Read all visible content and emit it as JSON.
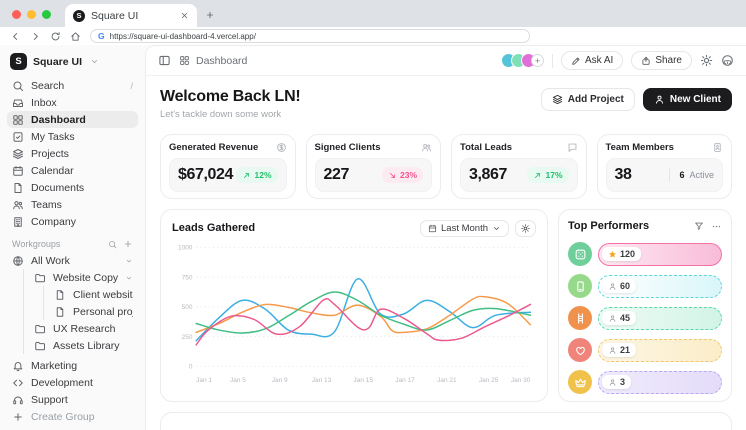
{
  "browser": {
    "tab_title": "Square UI",
    "url": "https://square-ui-dashboard-4.vercel.app/"
  },
  "sidebar": {
    "workspace": {
      "name": "Square UI",
      "logo_letter": "S"
    },
    "nav": [
      {
        "label": "Search",
        "icon": "search",
        "shortcut": "/"
      },
      {
        "label": "Inbox",
        "icon": "inbox"
      },
      {
        "label": "Dashboard",
        "icon": "grid",
        "active": true
      },
      {
        "label": "My Tasks",
        "icon": "tasks"
      },
      {
        "label": "Projects",
        "icon": "layers"
      },
      {
        "label": "Calendar",
        "icon": "calendar"
      },
      {
        "label": "Documents",
        "icon": "document"
      },
      {
        "label": "Teams",
        "icon": "people"
      },
      {
        "label": "Company",
        "icon": "building"
      }
    ],
    "workgroups": {
      "label": "Workgroups",
      "tree": [
        {
          "label": "All Work",
          "icon": "globe",
          "level": 0,
          "chevron": "down"
        },
        {
          "label": "Website Copy",
          "icon": "folder",
          "level": 1,
          "chevron": "down"
        },
        {
          "label": "Client website",
          "icon": "file",
          "level": 2
        },
        {
          "label": "Personal project",
          "icon": "file",
          "level": 2
        },
        {
          "label": "UX Research",
          "icon": "folder",
          "level": 1
        },
        {
          "label": "Assets Library",
          "icon": "folder",
          "level": 1
        }
      ]
    },
    "footer_nav": [
      {
        "label": "Marketing",
        "icon": "bell"
      },
      {
        "label": "Development",
        "icon": "code"
      },
      {
        "label": "Support",
        "icon": "headset"
      }
    ],
    "create_group": "Create Group"
  },
  "topbar": {
    "breadcrumb": "Dashboard",
    "ask_ai": "Ask AI",
    "share": "Share",
    "avatars": [
      {
        "color": "#56c4d8"
      },
      {
        "color": "#7fe0b8"
      },
      {
        "color": "#e06fd8"
      }
    ]
  },
  "welcome": {
    "title": "Welcome Back LN!",
    "subtitle": "Let's tackle down some work",
    "add_project": "Add Project",
    "new_client": "New Client"
  },
  "colors": {
    "positive": "#1fc16b",
    "negative": "#f6508c",
    "primary_button": "#1c1c1e"
  },
  "stats": [
    {
      "label": "Generated Revenue",
      "icon": "coin",
      "value": "$67,024",
      "trend": "up",
      "trend_value": "12%"
    },
    {
      "label": "Signed Clients",
      "icon": "people",
      "value": "227",
      "trend": "down",
      "trend_value": "23%"
    },
    {
      "label": "Total Leads",
      "icon": "chat",
      "value": "3,867",
      "trend": "up",
      "trend_value": "17%"
    },
    {
      "label": "Team Members",
      "icon": "badge",
      "value": "38",
      "trend": "none",
      "trend_value": "6 Active"
    }
  ],
  "chart_card": {
    "title": "Leads Gathered",
    "range_label": "Last Month"
  },
  "chart_data": {
    "type": "line",
    "title": "Leads Gathered",
    "xlabel": "",
    "ylabel": "",
    "x_tick_labels": [
      "Jan 1",
      "Jan 5",
      "Jan 9",
      "Jan 13",
      "Jan 15",
      "Jan 17",
      "Jan 21",
      "Jan 25",
      "Jan 30"
    ],
    "y_ticks": [
      0,
      250,
      500,
      750,
      1000
    ],
    "ylim": [
      0,
      1000
    ],
    "xlim": [
      1,
      30
    ],
    "grid": "dotted-horizontal",
    "legend": "none",
    "series": [
      {
        "name": "blue",
        "color": "#3bafe3",
        "points": [
          [
            1,
            215
          ],
          [
            3,
            410
          ],
          [
            5,
            555
          ],
          [
            7,
            480
          ],
          [
            9,
            305
          ],
          [
            11,
            270
          ],
          [
            13,
            290
          ],
          [
            15,
            735
          ],
          [
            17,
            440
          ],
          [
            19,
            440
          ],
          [
            21,
            555
          ],
          [
            23,
            460
          ],
          [
            25,
            325
          ],
          [
            27,
            430
          ],
          [
            30,
            455
          ]
        ]
      },
      {
        "name": "orange",
        "color": "#f59a4b",
        "points": [
          [
            1,
            285
          ],
          [
            3,
            360
          ],
          [
            5,
            455
          ],
          [
            7,
            520
          ],
          [
            9,
            495
          ],
          [
            11,
            450
          ],
          [
            13,
            430
          ],
          [
            15,
            515
          ],
          [
            17,
            420
          ],
          [
            18,
            300
          ],
          [
            19,
            285
          ],
          [
            21,
            315
          ],
          [
            23,
            430
          ],
          [
            25,
            565
          ],
          [
            26,
            585
          ],
          [
            28,
            530
          ],
          [
            30,
            350
          ]
        ]
      },
      {
        "name": "green",
        "color": "#41be83",
        "points": [
          [
            1,
            360
          ],
          [
            3,
            305
          ],
          [
            5,
            280
          ],
          [
            7,
            315
          ],
          [
            9,
            425
          ],
          [
            11,
            545
          ],
          [
            13,
            625
          ],
          [
            15,
            555
          ],
          [
            17,
            430
          ],
          [
            19,
            355
          ],
          [
            21,
            305
          ],
          [
            23,
            385
          ],
          [
            25,
            470
          ],
          [
            27,
            485
          ],
          [
            30,
            430
          ]
        ]
      },
      {
        "name": "pink",
        "color": "#ea5a8f",
        "points": [
          [
            1,
            180
          ],
          [
            2,
            300
          ],
          [
            4,
            420
          ],
          [
            6,
            395
          ],
          [
            8,
            270
          ],
          [
            10,
            335
          ],
          [
            12,
            555
          ],
          [
            13,
            520
          ],
          [
            15,
            330
          ],
          [
            16,
            325
          ],
          [
            17,
            480
          ],
          [
            19,
            405
          ],
          [
            21,
            275
          ],
          [
            22,
            220
          ],
          [
            24,
            235
          ],
          [
            26,
            330
          ],
          [
            28,
            420
          ],
          [
            30,
            520
          ]
        ]
      }
    ]
  },
  "performers": {
    "title": "Top Performers",
    "rows": [
      {
        "avatar_icon": "dice",
        "avatar_color": "#6fcf9b",
        "badge_icon": "star",
        "value": "120",
        "accent": "#f272a6",
        "fill_from": "#ffe9f3",
        "fill_to": "#f8bcd8",
        "border_style": "solid"
      },
      {
        "avatar_icon": "phone",
        "avatar_color": "#97d98b",
        "badge_icon": "person",
        "value": "60",
        "accent": "#5bd4de",
        "fill_from": "#ffffff",
        "fill_to": "#d9f6f9",
        "border_style": "dashed"
      },
      {
        "avatar_icon": "ladder",
        "avatar_color": "#f0924c",
        "badge_icon": "person",
        "value": "45",
        "accent": "#57d6a9",
        "fill_from": "#eefbf5",
        "fill_to": "#d2f4e6",
        "border_style": "dashed"
      },
      {
        "avatar_icon": "heart",
        "avatar_color": "#f0837a",
        "badge_icon": "person",
        "value": "21",
        "accent": "#f2c76b",
        "fill_from": "#fdf6e4",
        "fill_to": "#fbedc9",
        "border_style": "dashed"
      },
      {
        "avatar_icon": "crown",
        "avatar_color": "#f0c24b",
        "badge_icon": "person",
        "value": "3",
        "accent": "#b9a7ef",
        "fill_from": "#f0ebfc",
        "fill_to": "#e4dcf9",
        "border_style": "dashed"
      }
    ]
  }
}
